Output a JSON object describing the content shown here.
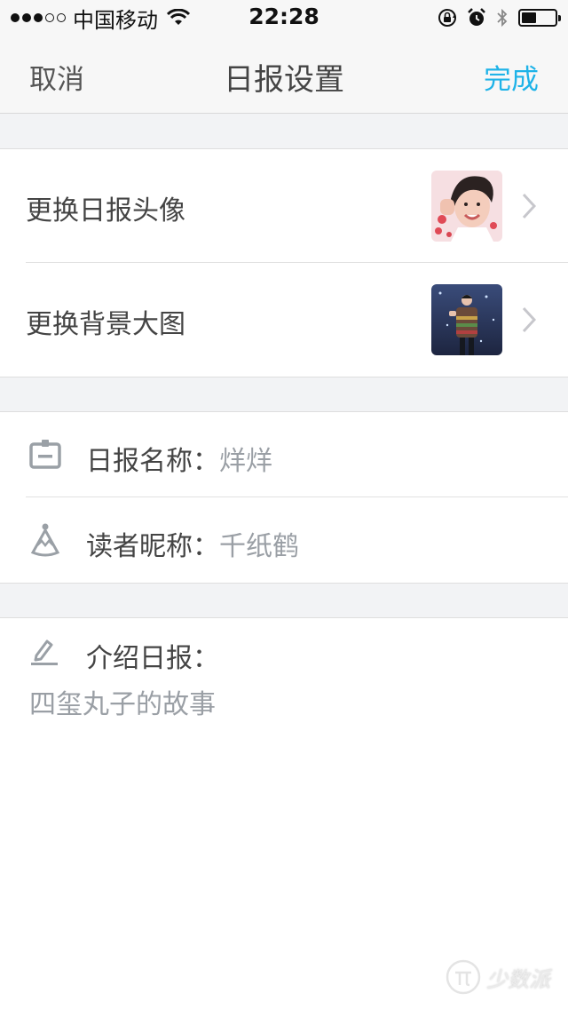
{
  "status_bar": {
    "carrier": "中国移动",
    "time": "22:28",
    "signal_bars_filled": 3,
    "signal_bars_total": 5,
    "battery_level": 0.45
  },
  "nav": {
    "cancel_label": "取消",
    "title": "日报设置",
    "done_label": "完成",
    "done_color": "#1fb3e8"
  },
  "image_settings": {
    "avatar_label": "更换日报头像",
    "background_label": "更换背景大图"
  },
  "fields": {
    "daily_name_label": "日报名称：",
    "daily_name_value": "烊烊",
    "reader_nickname_label": "读者昵称：",
    "reader_nickname_value": "千纸鹤"
  },
  "intro": {
    "label": "介绍日报：",
    "text": "四玺丸子的故事"
  },
  "watermark": {
    "text": "少数派"
  },
  "icons": {
    "avatar_chevron": "chevron-right-icon",
    "background_chevron": "chevron-right-icon",
    "name_field": "id-card-icon",
    "reader_field": "party-hat-icon",
    "intro_field": "pencil-icon"
  }
}
